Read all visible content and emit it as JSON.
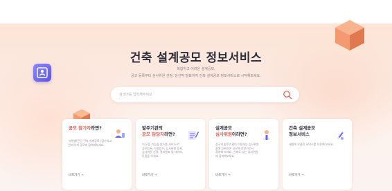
{
  "hero": {
    "title": "건축 설계공모 정보서비스",
    "subtitle_line1": "복잡하고 어려운 설계공모,",
    "subtitle_line2": "공고 등록부터 심사위원 선정, 당선작 발표까지 건축 설계공모 정보서비스로 시작해보세요."
  },
  "search": {
    "placeholder": "검색어를 입력해주세요"
  },
  "cards": [
    {
      "title_hl": "공모 참가자",
      "title_rest": "라면?",
      "desc": [
        "유형별(민간 건축 설계공모) 참가하고,",
        "편리하게 공모에 참여해보세요."
      ],
      "link": "바로가기 →"
    },
    {
      "title_line1": "발주기관의",
      "title_hl": "공모 담당자",
      "title_rest": "라면?",
      "desc": [
        "이 모든 기능을 원스톱 서비스로!",
        "공모등록, 작품접수, 심사위원 등록,",
        "심사위원 선정, 결과발표 및 데이터,",
        "투찰을 하세요."
      ],
      "link": "바로가기 →"
    },
    {
      "title_line1": "설계공모",
      "title_hl": "심사위원",
      "title_rest": "이라면?",
      "desc": [
        "전국의 발주기관이 이용하는 심사위원",
        "풀에 등록하여 공모에 전문가로서",
        "참여해 보세요. 신뢰도 있는 심사위원",
        "에 참여해보세요."
      ],
      "link": "바로가기 →"
    },
    {
      "title_line1": "건축 설계공모",
      "title_line2": "정보서비스",
      "desc": [
        "새롭게 오픈된 서비스를 이용해 보세요."
      ],
      "link": "바로가기 →"
    }
  ],
  "colors": {
    "accent": "#e85a4f",
    "blue_deco": "#6a63f0",
    "cube": "#f08a5f"
  },
  "icons": {
    "search": "search-icon",
    "card1": "user-pin-icon",
    "card2": "document-edit-icon",
    "card3": "user-check-icon",
    "card4": "pencil-tag-icon",
    "deco_left": "id-card-icon"
  }
}
